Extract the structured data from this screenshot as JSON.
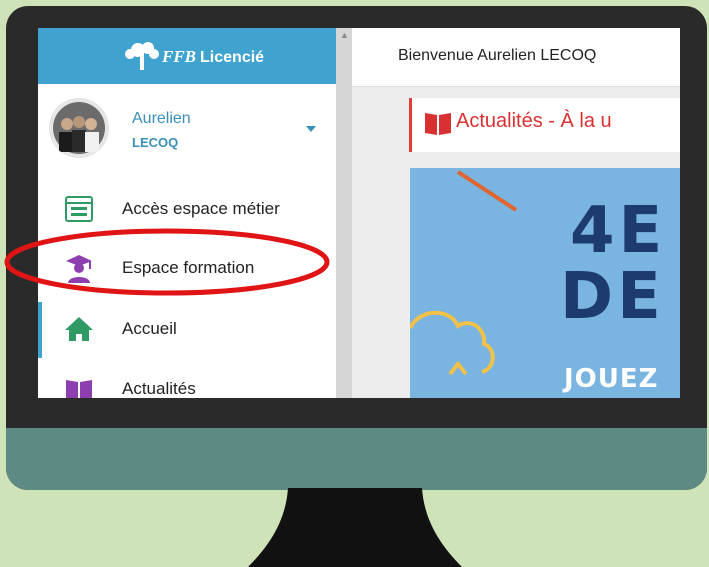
{
  "app": {
    "brand_prefix": "FFB",
    "brand_label": "Licencié"
  },
  "user": {
    "first_name": "Aurelien",
    "last_name": "LECOQ"
  },
  "sidebar": {
    "items": [
      {
        "label": "Accès espace métier",
        "icon": "dashboard-icon"
      },
      {
        "label": "Espace formation",
        "icon": "graduate-icon"
      },
      {
        "label": "Accueil",
        "icon": "home-icon"
      },
      {
        "label": "Actualités",
        "icon": "book-icon"
      }
    ]
  },
  "header": {
    "welcome": "Bienvenue Aurelien LECOQ"
  },
  "news": {
    "title": "Actualités - À la u"
  },
  "banner": {
    "line1": "4E",
    "line2": "DE",
    "line3": "JOUEZ"
  },
  "colors": {
    "accent": "#40a3cf",
    "highlight": "#e01414",
    "news_red": "#d93131",
    "background": "#cfe3b8",
    "monitor_chin": "#5d8a83"
  }
}
